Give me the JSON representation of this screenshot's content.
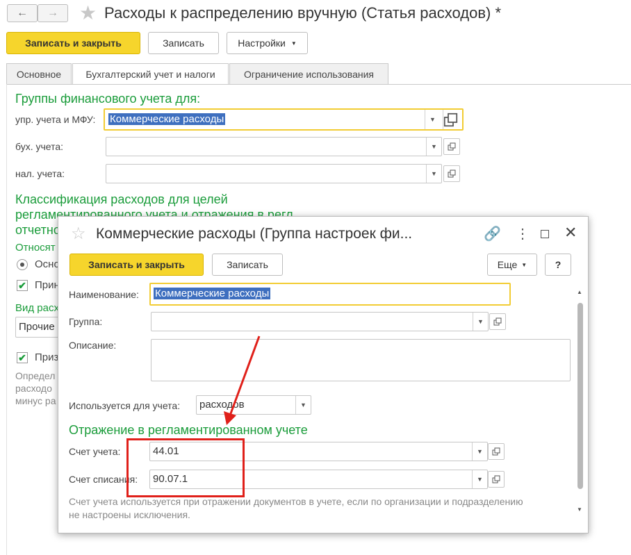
{
  "window": {
    "title": "Расходы к распределению вручную (Статья расходов) *",
    "toolbar": {
      "save_close": "Записать и закрыть",
      "save": "Записать",
      "settings": "Настройки"
    },
    "tabs": [
      "Основное",
      "Бухгалтерский учет и налоги",
      "Ограничение использования"
    ],
    "groups_title": "Группы финансового учета для:",
    "fields": [
      {
        "label": "упр. учета и МФУ:",
        "value": "Коммерческие расходы"
      },
      {
        "label": "бух. учета:",
        "value": ""
      },
      {
        "label": "нал. учета:",
        "value": ""
      }
    ],
    "classification_title_line1": "Классификация расходов для целей",
    "classification_title_line2": "регламентированного учета и отражения в регл.",
    "classification_title_line3": "отчетно",
    "rel_label": "Относят",
    "radio_label": "Осно",
    "check1_label": "Прин",
    "vid_label": "Вид расх",
    "vid_value": "Прочие",
    "check2_label": "Приз",
    "note_line1": "Определ",
    "note_line2": "расходо",
    "note_line3": "минус ра"
  },
  "dialog": {
    "title": "Коммерческие расходы (Группа настроек фи...",
    "toolbar": {
      "save_close": "Записать и закрыть",
      "save": "Записать",
      "more": "Еще",
      "help": "?"
    },
    "name_label": "Наименование:",
    "name_value": "Коммерческие расходы",
    "group_label": "Группа:",
    "group_value": "",
    "desc_label": "Описание:",
    "desc_value": "",
    "used_label": "Используется для учета:",
    "used_value": "расходов",
    "section_title": "Отражение в регламентированном учете",
    "account_label": "Счет учета:",
    "account_value": "44.01",
    "writeoff_label": "Счет списания:",
    "writeoff_value": "90.07.1",
    "note_line1": "Счет учета используется при отражении документов в учете, если по организации и подразделению",
    "note_line2": "не настроены исключения."
  },
  "colors": {
    "accent_green": "#1a9c3a",
    "primary_yellow": "#f6d52c",
    "highlight_red": "#e0201a"
  }
}
